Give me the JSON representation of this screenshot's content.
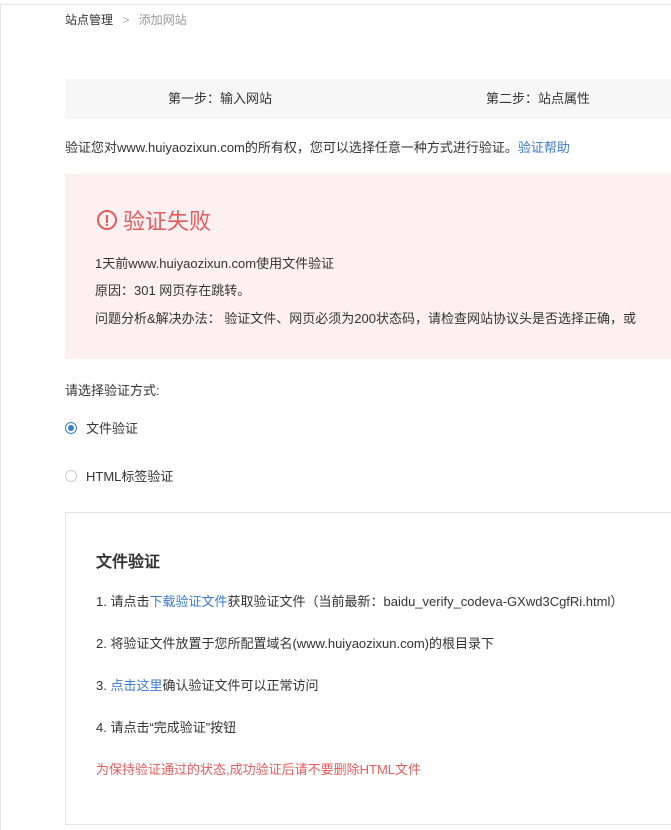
{
  "breadcrumb": {
    "root": "站点管理",
    "separator": ">",
    "current": "添加网站"
  },
  "steps": {
    "step1": "第一步：输入网站",
    "step2": "第二步：站点属性"
  },
  "intro": {
    "text": "验证您对www.huiyaozixun.com的所有权，您可以选择任意一种方式进行验证。",
    "help_link": "验证帮助"
  },
  "failure": {
    "title": "验证失败",
    "line1": "1天前www.huiyaozixun.com使用文件验证",
    "line2": "原因：301 网页存在跳转。",
    "line3": "问题分析&解决办法：  验证文件、网页必须为200状态码，请检查网站协议头是否选择正确，或"
  },
  "method": {
    "label": "请选择验证方式:",
    "options": [
      {
        "label": "文件验证",
        "selected": true
      },
      {
        "label": "HTML标签验证",
        "selected": false
      }
    ]
  },
  "file_verify": {
    "title": "文件验证",
    "step1_prefix": "1.  请点击",
    "step1_link": "下载验证文件",
    "step1_suffix": "获取验证文件（当前最新：baidu_verify_codeva-GXwd3CgfRi.html）",
    "step2": "2.  将验证文件放置于您所配置域名(www.huiyaozixun.com)的根目录下",
    "step3_prefix": "3.  ",
    "step3_link": "点击这里",
    "step3_suffix": "确认验证文件可以正常访问",
    "step4": "4.  请点击“完成验证”按钮",
    "warning": "为保持验证通过的状态,成功验证后请不要删除HTML文件"
  },
  "colors": {
    "link": "#3a7bd5",
    "error": "#e85b5b",
    "error_bg": "#fdf0f0"
  }
}
